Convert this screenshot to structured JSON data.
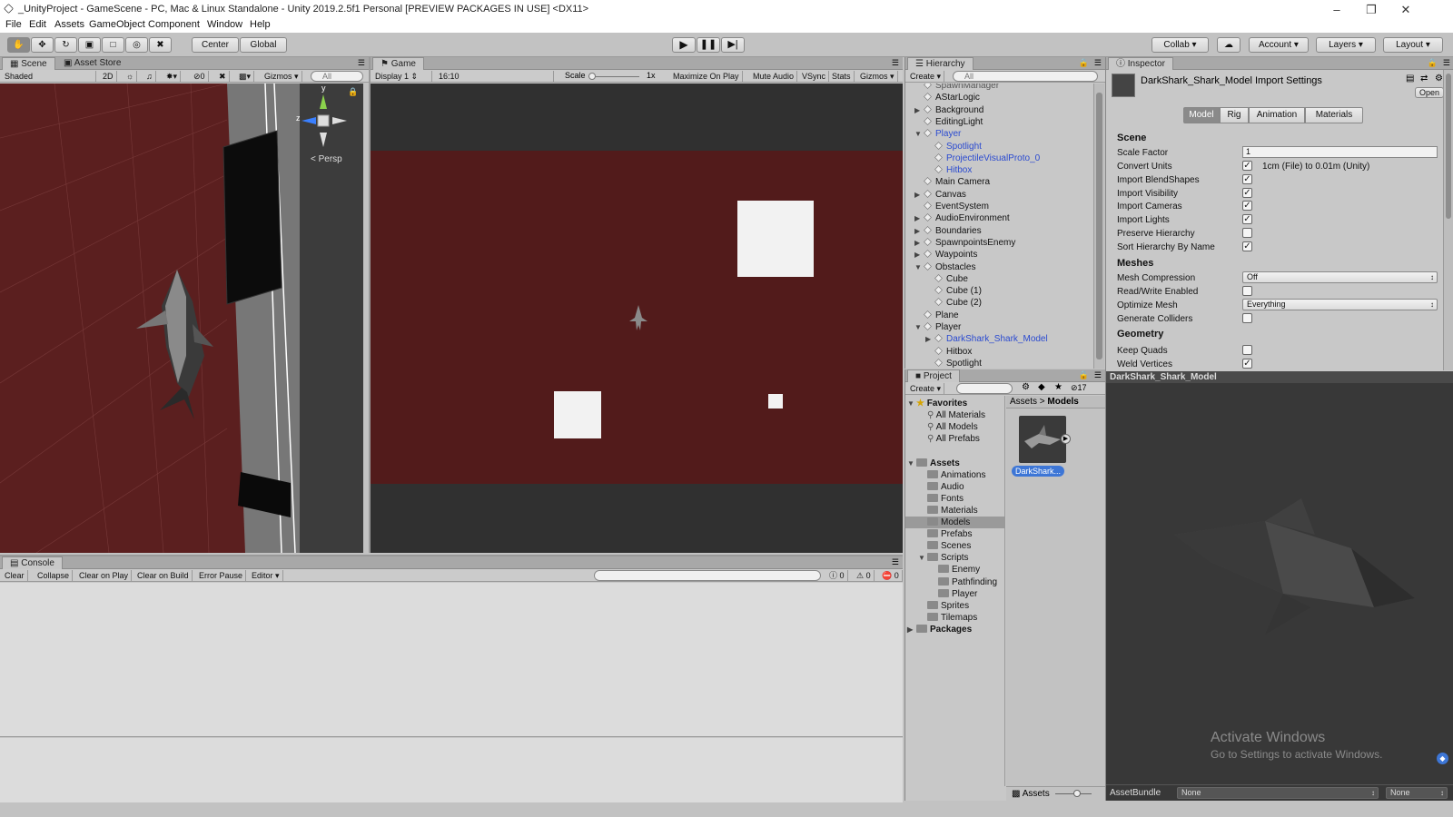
{
  "window": {
    "title": "_UnityProject - GameScene - PC, Mac & Linux Standalone - Unity 2019.2.5f1 Personal [PREVIEW PACKAGES IN USE] <DX11>",
    "minimize": "–",
    "restore": "❐",
    "close": "✕"
  },
  "menu": [
    "File",
    "Edit",
    "Assets",
    "GameObject",
    "Component",
    "Window",
    "Help"
  ],
  "toolbar": {
    "pivot": "Center",
    "space": "Global",
    "collab": "Collab",
    "account": "Account",
    "layers": "Layers",
    "layout": "Layout"
  },
  "scene": {
    "tabs": [
      "Scene",
      "Asset Store"
    ],
    "shading": "Shaded",
    "mode2d": "2D",
    "fx_count": "0",
    "gizmos": "Gizmos",
    "search_placeholder": "All",
    "persp": "< Persp",
    "axis_y": "y",
    "axis_z": "z"
  },
  "game": {
    "tab": "Game",
    "display": "Display 1",
    "aspect": "16:10",
    "scale_label": "Scale",
    "scale_value": "1x",
    "maximize": "Maximize On Play",
    "mute": "Mute Audio",
    "vsync": "VSync",
    "stats": "Stats",
    "gizmos": "Gizmos"
  },
  "hierarchy": {
    "tab": "Hierarchy",
    "create": "Create",
    "search_placeholder": "All",
    "items": [
      {
        "label": "SpawnManager",
        "indent": 0,
        "arrow": "",
        "style": "dim"
      },
      {
        "label": "AStarLogic",
        "indent": 0,
        "arrow": "",
        "style": ""
      },
      {
        "label": "Background",
        "indent": 0,
        "arrow": "▶",
        "style": ""
      },
      {
        "label": "EditingLight",
        "indent": 0,
        "arrow": "",
        "style": ""
      },
      {
        "label": "Player",
        "indent": 0,
        "arrow": "▼",
        "style": "blue"
      },
      {
        "label": "Spotlight",
        "indent": 1,
        "arrow": "",
        "style": "blue"
      },
      {
        "label": "ProjectileVisualProto_0",
        "indent": 1,
        "arrow": "",
        "style": "blue"
      },
      {
        "label": "Hitbox",
        "indent": 1,
        "arrow": "",
        "style": "blue"
      },
      {
        "label": "Main Camera",
        "indent": 0,
        "arrow": "",
        "style": ""
      },
      {
        "label": "Canvas",
        "indent": 0,
        "arrow": "▶",
        "style": ""
      },
      {
        "label": "EventSystem",
        "indent": 0,
        "arrow": "",
        "style": ""
      },
      {
        "label": "AudioEnvironment",
        "indent": 0,
        "arrow": "▶",
        "style": ""
      },
      {
        "label": "Boundaries",
        "indent": 0,
        "arrow": "▶",
        "style": ""
      },
      {
        "label": "SpawnpointsEnemy",
        "indent": 0,
        "arrow": "▶",
        "style": ""
      },
      {
        "label": "Waypoints",
        "indent": 0,
        "arrow": "▶",
        "style": ""
      },
      {
        "label": "Obstacles",
        "indent": 0,
        "arrow": "▼",
        "style": ""
      },
      {
        "label": "Cube",
        "indent": 1,
        "arrow": "",
        "style": ""
      },
      {
        "label": "Cube (1)",
        "indent": 1,
        "arrow": "",
        "style": ""
      },
      {
        "label": "Cube (2)",
        "indent": 1,
        "arrow": "",
        "style": ""
      },
      {
        "label": "Plane",
        "indent": 0,
        "arrow": "",
        "style": ""
      },
      {
        "label": "Player",
        "indent": 0,
        "arrow": "▼",
        "style": ""
      },
      {
        "label": "DarkShark_Shark_Model",
        "indent": 1,
        "arrow": "▶",
        "style": "blue"
      },
      {
        "label": "Hitbox",
        "indent": 1,
        "arrow": "",
        "style": ""
      },
      {
        "label": "Spotlight",
        "indent": 1,
        "arrow": "",
        "style": ""
      }
    ]
  },
  "project": {
    "tab": "Project",
    "create": "Create",
    "count": "17",
    "tree": [
      {
        "label": "Favorites",
        "indent": 0,
        "arrow": "▼",
        "kind": "star",
        "bold": true
      },
      {
        "label": "All Materials",
        "indent": 1,
        "arrow": "",
        "kind": "search",
        "bold": false
      },
      {
        "label": "All Models",
        "indent": 1,
        "arrow": "",
        "kind": "search",
        "bold": false
      },
      {
        "label": "All Prefabs",
        "indent": 1,
        "arrow": "",
        "kind": "search",
        "bold": false
      },
      {
        "label": "",
        "indent": 0,
        "arrow": "",
        "kind": "none",
        "bold": false
      },
      {
        "label": "Assets",
        "indent": 0,
        "arrow": "▼",
        "kind": "folder",
        "bold": true
      },
      {
        "label": "Animations",
        "indent": 1,
        "arrow": "",
        "kind": "folder",
        "bold": false
      },
      {
        "label": "Audio",
        "indent": 1,
        "arrow": "",
        "kind": "folder",
        "bold": false
      },
      {
        "label": "Fonts",
        "indent": 1,
        "arrow": "",
        "kind": "folder",
        "bold": false
      },
      {
        "label": "Materials",
        "indent": 1,
        "arrow": "",
        "kind": "folder",
        "bold": false
      },
      {
        "label": "Models",
        "indent": 1,
        "arrow": "",
        "kind": "folder",
        "bold": false,
        "selected": true
      },
      {
        "label": "Prefabs",
        "indent": 1,
        "arrow": "",
        "kind": "folder",
        "bold": false
      },
      {
        "label": "Scenes",
        "indent": 1,
        "arrow": "",
        "kind": "folder",
        "bold": false
      },
      {
        "label": "Scripts",
        "indent": 1,
        "arrow": "▼",
        "kind": "folder",
        "bold": false
      },
      {
        "label": "Enemy",
        "indent": 2,
        "arrow": "",
        "kind": "folder",
        "bold": false
      },
      {
        "label": "Pathfinding",
        "indent": 2,
        "arrow": "",
        "kind": "folder",
        "bold": false
      },
      {
        "label": "Player",
        "indent": 2,
        "arrow": "",
        "kind": "folder",
        "bold": false
      },
      {
        "label": "Sprites",
        "indent": 1,
        "arrow": "",
        "kind": "folder",
        "bold": false
      },
      {
        "label": "Tilemaps",
        "indent": 1,
        "arrow": "",
        "kind": "folder",
        "bold": false
      },
      {
        "label": "Packages",
        "indent": 0,
        "arrow": "▶",
        "kind": "folder",
        "bold": true
      }
    ],
    "breadcrumb": {
      "root": "Assets",
      "sep": ">",
      "current": "Models"
    },
    "asset_label": "DarkShark...",
    "footer": "Assets"
  },
  "inspector": {
    "tab": "Inspector",
    "title": "DarkShark_Shark_Model Import Settings",
    "open": "Open",
    "tabs": [
      "Model",
      "Rig",
      "Animation",
      "Materials"
    ],
    "scene_header": "Scene",
    "scale_factor_label": "Scale Factor",
    "scale_factor_value": "1",
    "convert_units_label": "Convert Units",
    "convert_units_note": "1cm (File) to 0.01m (Unity)",
    "checks": [
      {
        "label": "Import BlendShapes",
        "checked": true
      },
      {
        "label": "Import Visibility",
        "checked": true
      },
      {
        "label": "Import Cameras",
        "checked": true
      },
      {
        "label": "Import Lights",
        "checked": true
      },
      {
        "label": "Preserve Hierarchy",
        "checked": false
      },
      {
        "label": "Sort Hierarchy By Name",
        "checked": true
      }
    ],
    "meshes_header": "Meshes",
    "mesh_compression_label": "Mesh Compression",
    "mesh_compression_value": "Off",
    "readwrite_label": "Read/Write Enabled",
    "optimize_label": "Optimize Mesh",
    "optimize_value": "Everything",
    "colliders_label": "Generate Colliders",
    "geometry_header": "Geometry",
    "keep_quads_label": "Keep Quads",
    "weld_label": "Weld Vertices",
    "preview_title": "DarkShark_Shark_Model",
    "watermark_1": "Activate Windows",
    "watermark_2": "Go to Settings to activate Windows.",
    "assetbundle_label": "AssetBundle",
    "assetbundle_value": "None",
    "assetbundle_variant": "None"
  },
  "console": {
    "tab": "Console",
    "buttons": [
      "Clear",
      "Collapse",
      "Clear on Play",
      "Clear on Build",
      "Error Pause",
      "Editor"
    ],
    "info_count": "0",
    "warn_count": "0",
    "error_count": "0"
  },
  "colors": {
    "scene_floor": "#5a1e1e",
    "game_bg": "#521b1b",
    "editor_gray": "#c2c2c2",
    "selection_blue": "#3d76d6"
  }
}
